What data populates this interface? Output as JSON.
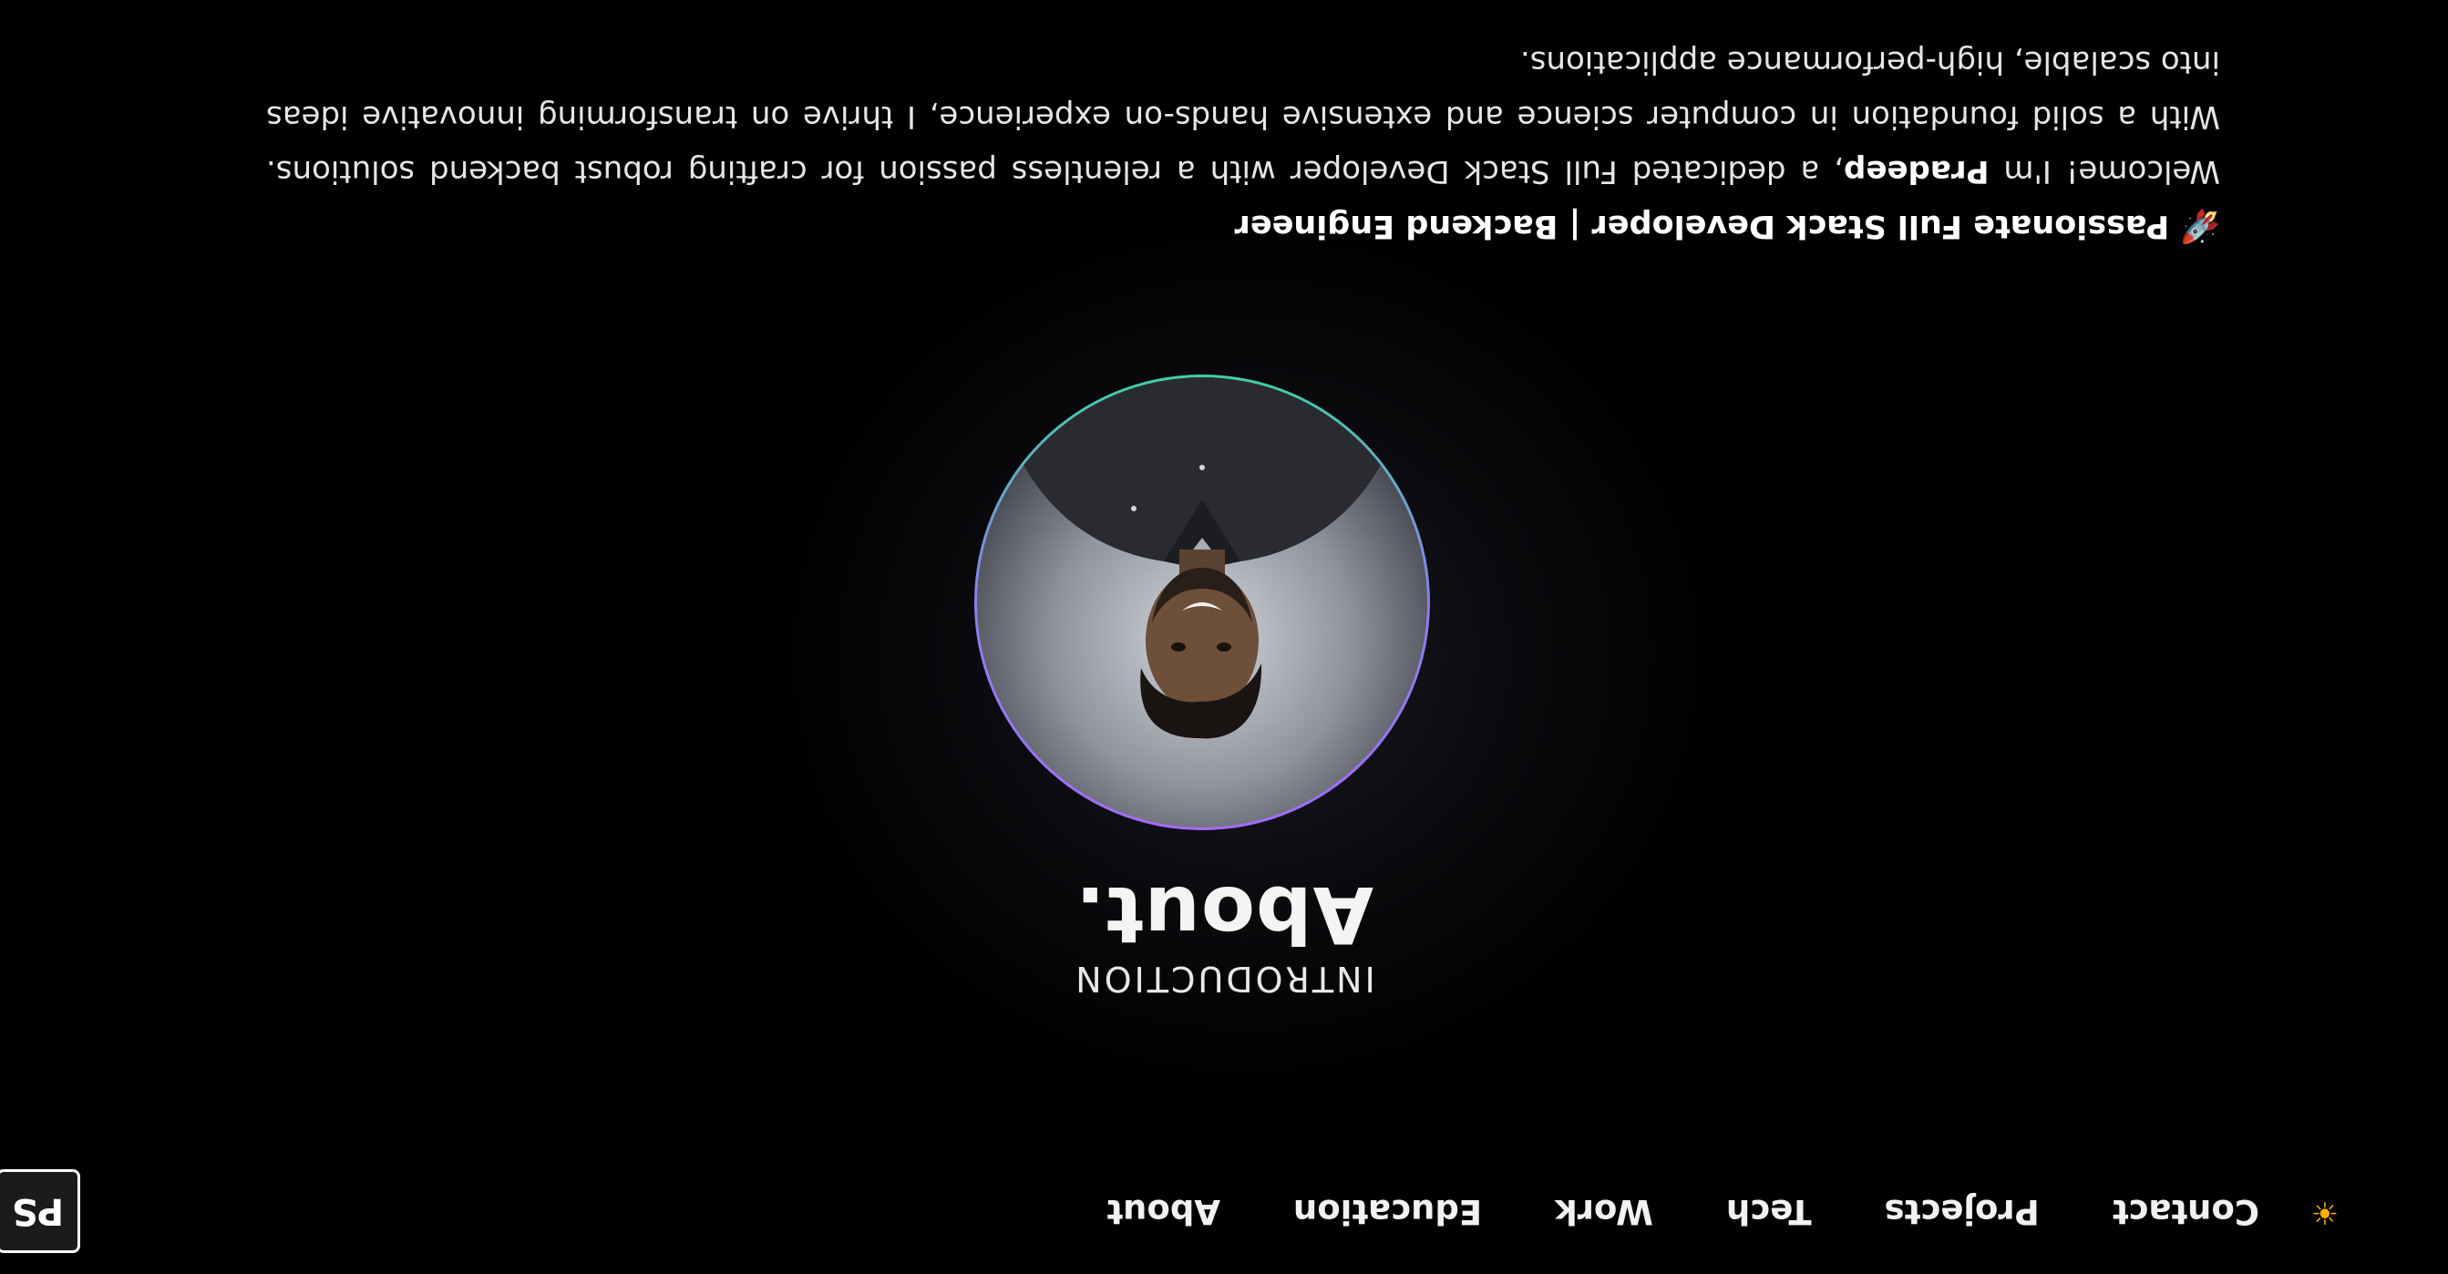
{
  "logo": {
    "text": "PS"
  },
  "nav": {
    "items": [
      "About",
      "Education",
      "Work",
      "Tech",
      "Projects",
      "Contact"
    ],
    "theme_icon": "sun-icon",
    "theme_glyph": "☀"
  },
  "about": {
    "label": "INTRODUCTION",
    "title": "About."
  },
  "intro": {
    "tagline": "🚀 Passionate Full Stack Developer | Backend Engineer",
    "bio_prefix": "Welcome! I'm ",
    "name": "Pradeep",
    "bio_suffix": ", a dedicated Full Stack Developer with a relentless passion for crafting robust backend solutions. With a solid foundation in computer science and extensive hands-on experience, I thrive on transforming innovative ideas into scalable, high-performance applications."
  },
  "colors": {
    "background": "#000000",
    "text": "#ffffff",
    "avatar_ring_top": "#a46cff",
    "avatar_ring_bottom": "#3fd1a6",
    "sun": "#ffb000"
  }
}
